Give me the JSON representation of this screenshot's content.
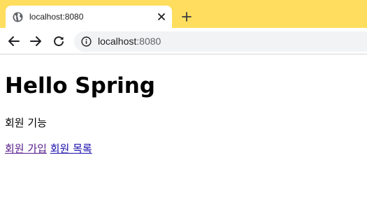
{
  "browser": {
    "tab": {
      "title": "localhost:8080",
      "favicon": "globe-icon",
      "close_icon": "close-icon"
    },
    "new_tab_icon": "plus-icon",
    "toolbar": {
      "back_icon": "back-arrow-icon",
      "forward_icon": "forward-arrow-icon",
      "reload_icon": "reload-icon",
      "site_info_icon": "info-icon",
      "url_host": "localhost",
      "url_port": ":8080"
    },
    "colors": {
      "tabstrip": "#ffde5f",
      "omnibox": "#f1f3f4",
      "link": "#1a0dab",
      "visited_link": "#551a8b"
    }
  },
  "page": {
    "heading": "Hello Spring",
    "text": "회원 기능",
    "links": [
      {
        "label": "회원 가입",
        "visited": true
      },
      {
        "label": "회원 목록",
        "visited": false
      }
    ]
  }
}
